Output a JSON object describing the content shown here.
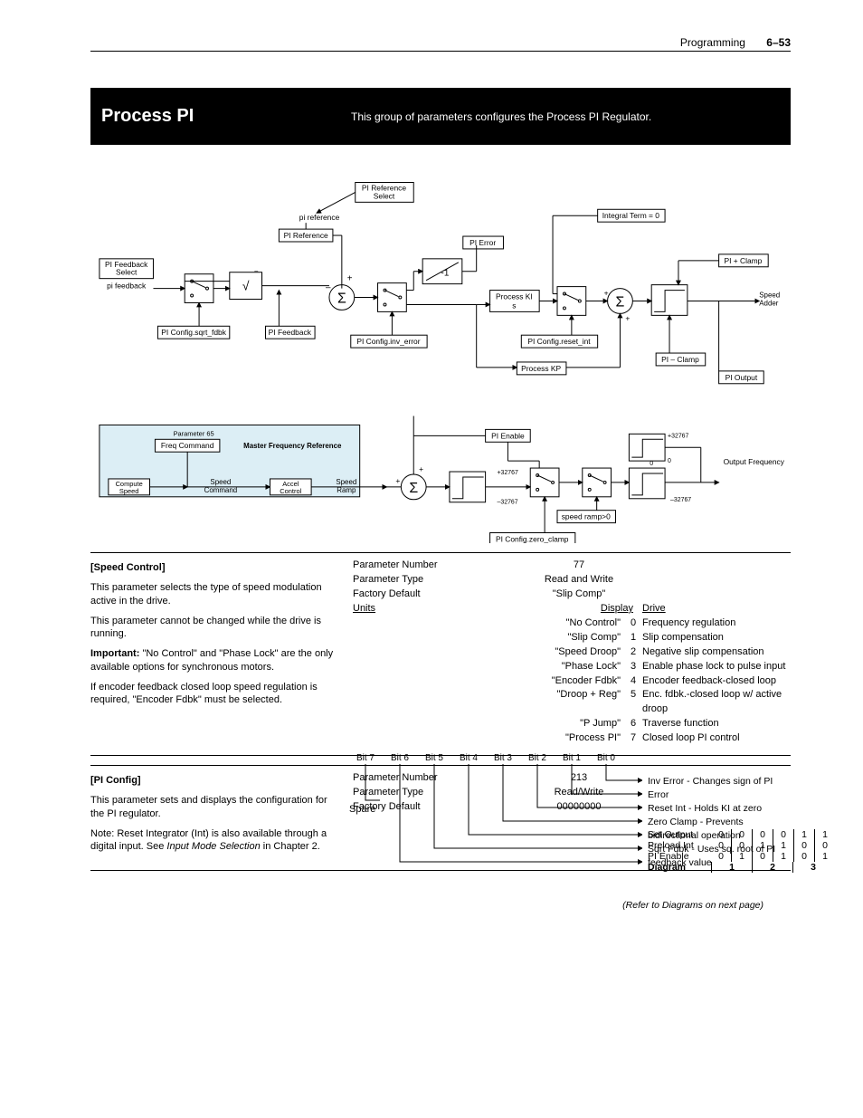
{
  "header": {
    "section": "Programming",
    "page": "6–53"
  },
  "titlebar": {
    "title": "Process PI",
    "description": "This group of parameters configures the Process PI Regulator."
  },
  "chart_data": [
    {
      "type": "block-diagram",
      "title": "PI Regulator signal flow",
      "blocks": [
        "PI Feedback Select",
        "PI Reference Select",
        "PI Reference",
        "PI Feedback",
        "PI Config.sqrt_fdbk",
        "PI Error",
        "PI Config.inv_error",
        "Process KI s",
        "Integral Term = 0",
        "PI Config.reset_int",
        "Process KP",
        "PI + Clamp",
        "PI – Clamp",
        "PI Output",
        "Speed Adder"
      ],
      "operators": [
        "sqrt",
        "sum (-)+",
        "-1 gain",
        "switch x3",
        "sum (+)+",
        "limit"
      ],
      "signals": [
        "pi feedback",
        "pi reference"
      ]
    },
    {
      "type": "block-diagram",
      "title": "Master Frequency Reference path",
      "panel": "Parameter 65 / Master Frequency Reference",
      "blocks": [
        "Compute Speed",
        "Freq Command",
        "Speed Command",
        "Accel Control",
        "Speed Ramp",
        "PI Enable",
        "speed ramp>0",
        "PI Config.zero_clamp",
        "Output Frequency"
      ],
      "limits": [
        "+32767",
        "-32767",
        "+32767",
        "0",
        "0",
        "-32767"
      ],
      "operators": [
        "sum (+)+",
        "limit x2",
        "switch x2"
      ]
    }
  ],
  "speed_control": {
    "heading": "[Speed Control]",
    "p1": "This parameter selects the type of speed modulation active in the drive.",
    "p2": "This parameter cannot be changed while the drive is running.",
    "p3a": "Important:",
    "p3b": " \"No Control\" and \"Phase Lock\" are the only available options for synchronous motors.",
    "p4": "If encoder feedback closed loop speed regulation is required, \"Encoder Fdbk\" must be selected.",
    "labels": {
      "pn": "Parameter Number",
      "pt": "Parameter Type",
      "fd": "Factory Default",
      "un": "Units"
    },
    "values": {
      "pn": "77",
      "pt": "Read and Write",
      "fd": "\"Slip Comp\""
    },
    "display": "Display",
    "drive": "Drive",
    "options": [
      {
        "name": "\"No Control\"",
        "num": "0",
        "desc": "Frequency regulation"
      },
      {
        "name": "\"Slip Comp\"",
        "num": "1",
        "desc": "Slip compensation"
      },
      {
        "name": "\"Speed Droop\"",
        "num": "2",
        "desc": "Negative slip compensation"
      },
      {
        "name": "\"Phase Lock\"",
        "num": "3",
        "desc": "Enable phase lock to pulse input"
      },
      {
        "name": "\"Encoder Fdbk\"",
        "num": "4",
        "desc": "Encoder feedback-closed loop"
      },
      {
        "name": "\"Droop + Reg\"",
        "num": "5",
        "desc": "Enc. fdbk.-closed loop w/ active droop"
      },
      {
        "name": "\"P Jump\"",
        "num": "6",
        "desc": "Traverse function"
      },
      {
        "name": "\"Process PI\"",
        "num": "7",
        "desc": "Closed loop PI control"
      }
    ]
  },
  "pi_config": {
    "heading": "[PI Config]",
    "p1": "This parameter sets and displays the configuration for the PI regulator.",
    "p2a": "Note: Reset Integrator (Int) is also available through a digital input. See ",
    "p2b": "Input Mode Selection",
    "p2c": " in Chapter 2.",
    "labels": {
      "pn": "Parameter Number",
      "pt": "Parameter Type",
      "fd": "Factory Default"
    },
    "values": {
      "pn": "213",
      "pt": "Read/Write",
      "fd": "00000000"
    },
    "bits": [
      "Bit 7",
      "Bit 6",
      "Bit 5",
      "Bit 4",
      "Bit 3",
      "Bit 2",
      "Bit 1",
      "Bit 0"
    ],
    "spare": "Spare",
    "desc_lines": [
      "Inv Error - Changes sign of PI Error",
      "Reset Int - Holds KI at zero",
      "Zero Clamp - Prevents bidirectional operation",
      "Sqrt Fdbk - Uses sq. root of PI feedback value"
    ],
    "truth_rows": [
      {
        "label": "Set Output",
        "vals": [
          "0",
          "0",
          "0",
          "0",
          "1",
          "1"
        ]
      },
      {
        "label": "Preload Int",
        "vals": [
          "0",
          "0",
          "1",
          "1",
          "0",
          "0"
        ]
      },
      {
        "label": "PI Enable",
        "vals": [
          "0",
          "1",
          "0",
          "1",
          "0",
          "1"
        ]
      }
    ],
    "diag_label": "Diagram",
    "diag_vals": [
      "1",
      "2",
      "3"
    ],
    "footnote": "(Refer to Diagrams on next page)"
  }
}
